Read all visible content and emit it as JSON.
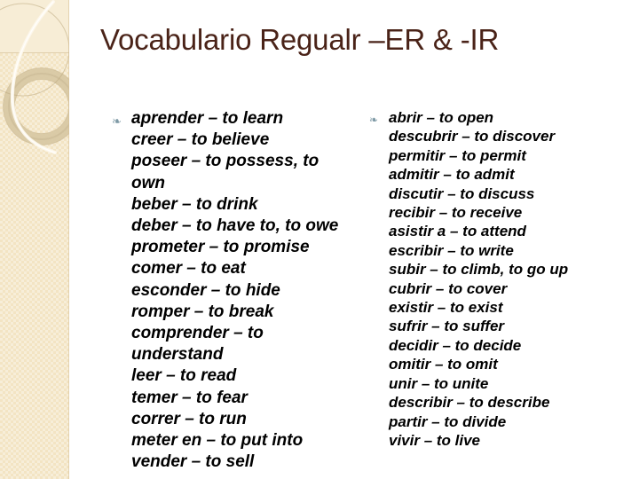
{
  "slide": {
    "title": "Vocabulario Regualr –ER & -IR",
    "background_color": "#ffffff",
    "title_color": "#4a2318",
    "body_text_color": "#000000",
    "accent_band_color": "#f3e4c3",
    "bullet_color": "#7c98a4",
    "bullet_glyph": "❧"
  },
  "columns": {
    "left": {
      "bullet": "❧",
      "entries": [
        "aprender – to learn",
        "creer – to believe",
        "poseer – to possess, to own",
        "beber – to drink",
        "deber – to have to, to owe",
        "prometer – to promise",
        "comer – to eat",
        "esconder – to hide",
        "romper – to break",
        "comprender – to understand",
        "leer – to read",
        "temer – to fear",
        "correr – to run",
        "meter en – to put into",
        "vender – to sell"
      ]
    },
    "right": {
      "bullet": "❧",
      "entries": [
        "abrir – to open",
        "descubrir – to discover",
        "permitir – to permit",
        "admitir – to admit",
        "discutir – to discuss",
        "recibir – to receive",
        "asistir a – to attend",
        "escribir – to write",
        "subir – to climb, to go up",
        "cubrir – to cover",
        "existir – to exist",
        "sufrir – to suffer",
        "decidir – to decide",
        "omitir – to omit",
        "unir – to unite",
        "describir – to describe",
        "partir – to divide",
        "vivir – to live"
      ]
    }
  }
}
